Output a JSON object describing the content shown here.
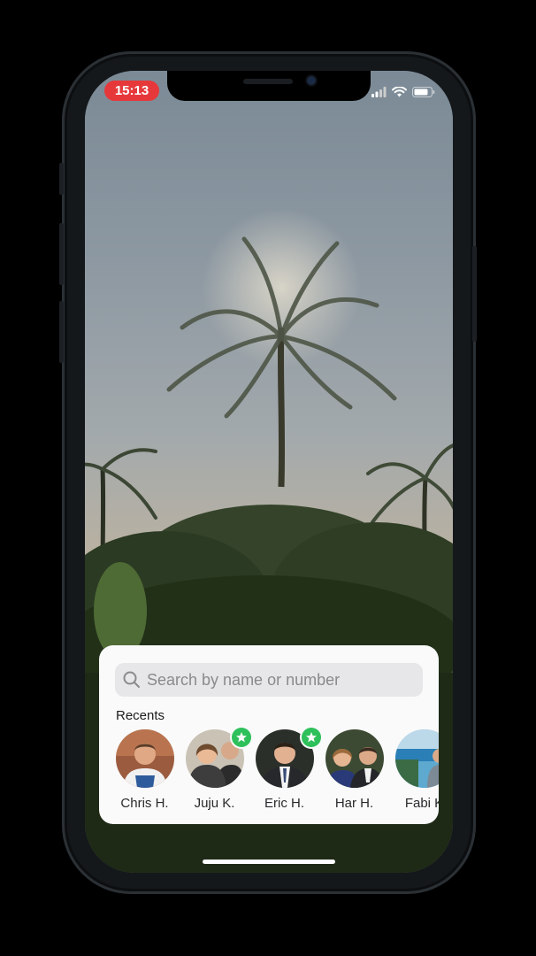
{
  "status_bar": {
    "time": "15:13",
    "icons": [
      "signal-icon",
      "wifi-icon",
      "battery-icon"
    ],
    "time_pill_color": "#e6383a"
  },
  "share_sheet": {
    "search": {
      "placeholder": "Search by name or number",
      "value": ""
    },
    "recents_label": "Recents",
    "contacts": [
      {
        "name": "Chris H.",
        "favorite": false
      },
      {
        "name": "Juju K.",
        "favorite": true
      },
      {
        "name": "Eric H.",
        "favorite": true
      },
      {
        "name": "Har H.",
        "favorite": false
      },
      {
        "name": "Fabi K",
        "favorite": false
      }
    ],
    "favorite_badge_color": "#2ec05b"
  }
}
